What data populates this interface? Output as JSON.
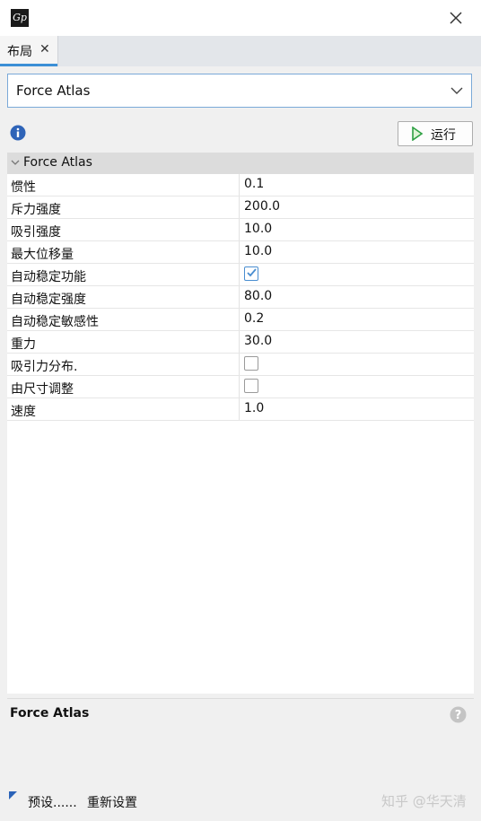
{
  "titlebar": {
    "logo_text": "Gp"
  },
  "tab": {
    "label": "布局",
    "close": "✕"
  },
  "layout_select": {
    "value": "Force Atlas"
  },
  "toolbar": {
    "run_label": "运行"
  },
  "section": {
    "title": "Force Atlas"
  },
  "properties": [
    {
      "name": "惯性",
      "value": "0.1"
    },
    {
      "name": "斥力强度",
      "value": "200.0"
    },
    {
      "name": "吸引强度",
      "value": "10.0"
    },
    {
      "name": "最大位移量",
      "value": "10.0"
    },
    {
      "name": "自动稳定功能",
      "value": true
    },
    {
      "name": "自动稳定强度",
      "value": "80.0"
    },
    {
      "name": "自动稳定敏感性",
      "value": "0.2"
    },
    {
      "name": "重力",
      "value": "30.0"
    },
    {
      "name": "吸引力分布.",
      "value": false
    },
    {
      "name": "由尺寸调整",
      "value": false
    },
    {
      "name": "速度",
      "value": "1.0"
    }
  ],
  "description": {
    "title": "Force Atlas"
  },
  "footer": {
    "preset_label": "预设......",
    "reset_label": "重新设置"
  },
  "watermark": "知乎 @华天清",
  "colors": {
    "accent": "#3c8fd6",
    "checkbox_checked": "#4a8ed0",
    "run_icon": "#2ea043"
  }
}
